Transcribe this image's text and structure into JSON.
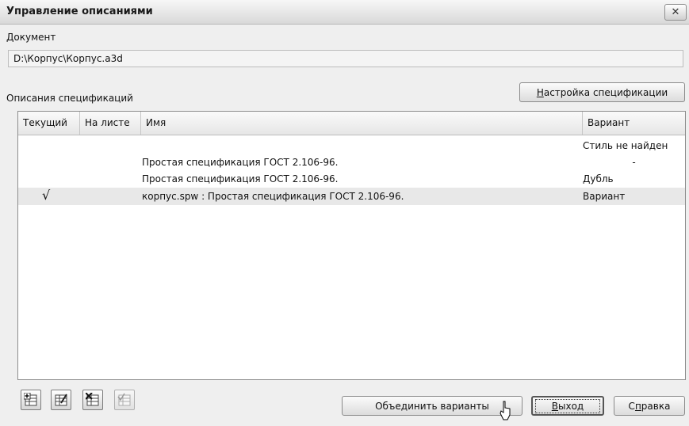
{
  "window": {
    "title": "Управление описаниями",
    "close_glyph": "✕"
  },
  "document": {
    "label": "Документ",
    "path": "D:\\Корпус\\Корпус.a3d"
  },
  "specs": {
    "label": "Описания спецификаций",
    "setup_button": {
      "mnemonic": "Н",
      "rest": "астройка спецификации"
    }
  },
  "table": {
    "columns": [
      "Текущий",
      "На листе",
      "Имя",
      "Вариант"
    ],
    "rows": [
      {
        "current": "",
        "on_sheet": "",
        "name": "",
        "variant": "Стиль не найден",
        "selected": false
      },
      {
        "current": "",
        "on_sheet": "",
        "name": "Простая спецификация ГОСТ 2.106-96.",
        "variant": "-",
        "selected": false
      },
      {
        "current": "",
        "on_sheet": "",
        "name": "Простая спецификация ГОСТ 2.106-96.",
        "variant": "Дубль",
        "selected": false
      },
      {
        "current": "√",
        "on_sheet": "",
        "name": "корпус.spw : Простая спецификация ГОСТ 2.106-96.",
        "variant": "Вариант",
        "selected": true
      }
    ]
  },
  "toolbar": {
    "icons": [
      "add-spec-icon",
      "edit-spec-icon",
      "delete-spec-icon",
      "apply-spec-icon"
    ]
  },
  "buttons": {
    "merge": "Объединить варианты",
    "exit": {
      "mnemonic": "В",
      "rest": "ыход"
    },
    "help": {
      "pre": "С",
      "mnemonic": "п",
      "rest": "равка"
    }
  },
  "colors": {
    "selected_row": "#e8e8e8",
    "window_bg": "#efefef"
  }
}
